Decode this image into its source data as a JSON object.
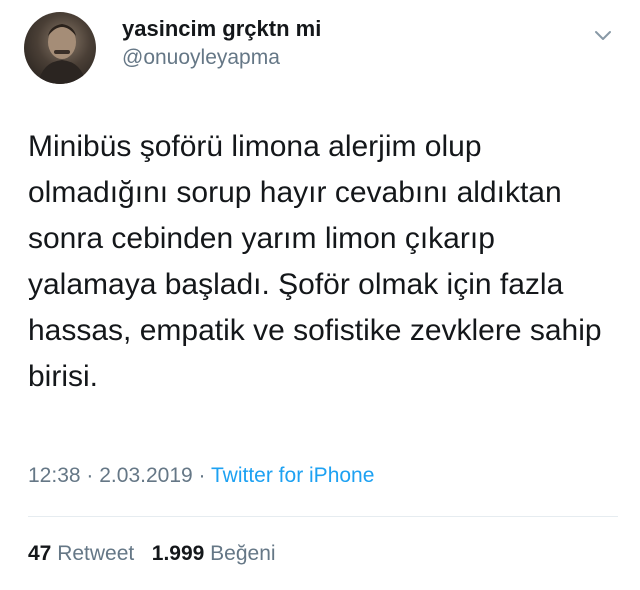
{
  "user": {
    "display_name": "yasincim grçktn mi",
    "handle": "@onuoyleyapma"
  },
  "tweet": {
    "text": "Minibüs şoförü limona alerjim olup olmadığını sorup hayır cevabını aldıktan sonra cebinden yarım limon çıkarıp yalamaya başladı. Şoför olmak için fazla hassas, empatik ve sofistike zevklere sahip birisi.",
    "time": "12:38",
    "sep1": "·",
    "date": "2.03.2019",
    "sep2": "·",
    "source": "Twitter for iPhone"
  },
  "stats": {
    "retweets": "47",
    "retweet_label": "Retweet",
    "likes": "1.999",
    "like_label": "Beğeni"
  },
  "icons": {
    "menu": "chevron-down-icon"
  },
  "colors": {
    "link": "#1da1f2",
    "muted": "#657786",
    "text": "#14171a"
  }
}
